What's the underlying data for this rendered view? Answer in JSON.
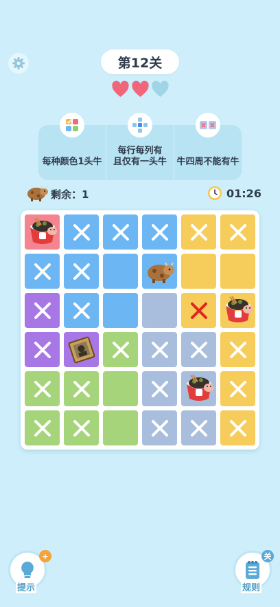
{
  "header": {
    "level_title": "第12关",
    "lives_total": 3,
    "lives_remaining": 2
  },
  "rules": [
    {
      "icon": "color-grid-icon",
      "text": "每种颜色1头牛"
    },
    {
      "icon": "row-column-cross-icon",
      "text": "每行每列有\n且仅有一头牛"
    },
    {
      "icon": "no-adjacent-icon",
      "text": "牛四周不能有牛"
    }
  ],
  "status": {
    "remaining_label": "剩余：",
    "remaining_count": "1",
    "timer": "01:26"
  },
  "colors": {
    "background": "#cdeefa",
    "heart_full": "#f0667a",
    "heart_empty": "#9fd5e6",
    "accent_orange": "#f5a23a",
    "error_red": "#e62323",
    "region_pink": "#f4848f",
    "region_blue": "#6cb6f4",
    "region_yellow": "#f6cd5a",
    "region_purple": "#a877e6",
    "region_green": "#a5d47a",
    "region_slate": "#a9bedc"
  },
  "board": {
    "size": 6,
    "regions": [
      [
        "pink",
        "blue",
        "blue",
        "blue",
        "yellow",
        "yellow"
      ],
      [
        "blue",
        "blue",
        "blue",
        "blue",
        "yellow",
        "yellow"
      ],
      [
        "purple",
        "blue",
        "blue",
        "slate",
        "yellow",
        "yellow"
      ],
      [
        "purple",
        "purple",
        "green",
        "slate",
        "slate",
        "yellow"
      ],
      [
        "green",
        "green",
        "green",
        "slate",
        "slate",
        "yellow"
      ],
      [
        "green",
        "green",
        "green",
        "slate",
        "slate",
        "yellow"
      ]
    ],
    "marks": [
      [
        "cow",
        "x",
        "x",
        "x",
        "x",
        "x"
      ],
      [
        "x",
        "x",
        "",
        "brown-cow",
        "",
        ""
      ],
      [
        "x",
        "x",
        "",
        "",
        "red-x",
        "cow"
      ],
      [
        "x",
        "photo-cow",
        "x",
        "x",
        "x",
        "x"
      ],
      [
        "x",
        "x",
        "",
        "x",
        "cow",
        "x"
      ],
      [
        "x",
        "x",
        "",
        "x",
        "x",
        "x"
      ]
    ]
  },
  "footer": {
    "hint_label": "提示",
    "hint_badge": "+",
    "rules_label": "规则",
    "rules_badge": "关"
  }
}
